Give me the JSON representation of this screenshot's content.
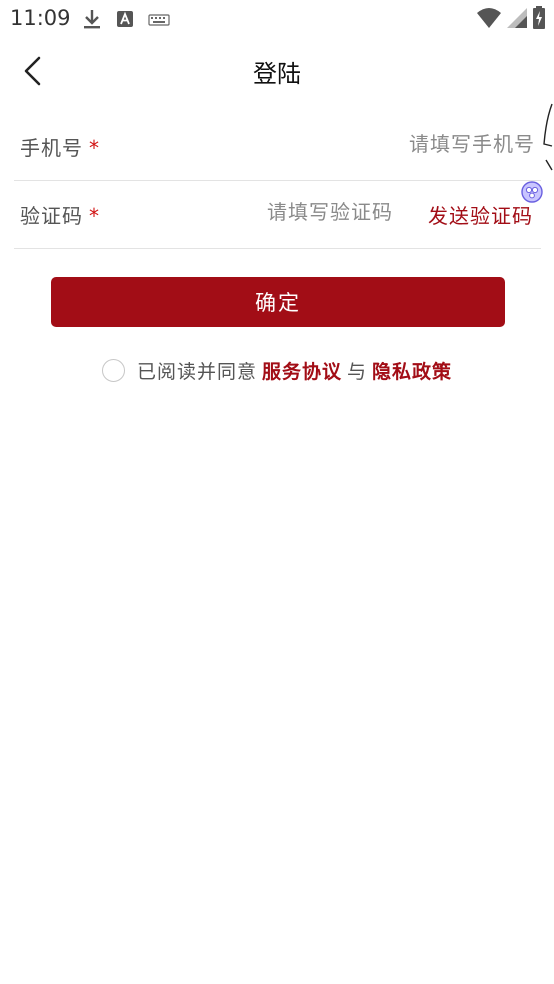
{
  "status_bar": {
    "time": "11:09",
    "left_icons": [
      "download-icon",
      "text-a-icon",
      "keyboard-icon"
    ],
    "right_icons": [
      "wifi-icon",
      "cellular-signal-icon",
      "battery-charging-icon"
    ]
  },
  "header": {
    "back_icon": "chevron-left-icon",
    "title": "登陆"
  },
  "form": {
    "phone": {
      "label": "手机号",
      "required_mark": "*",
      "value": "",
      "placeholder": "请填写手机号"
    },
    "code": {
      "label": "验证码",
      "required_mark": "*",
      "value": "",
      "placeholder": "请填写验证码",
      "send_label": "发送验证码"
    }
  },
  "confirm_label": "确定",
  "agreement": {
    "checked": false,
    "prefix": "已阅读并同意",
    "terms_link": "服务协议",
    "conjunction": "与",
    "privacy_link": "隐私政策"
  },
  "colors": {
    "accent": "#a20d16",
    "required": "#d21414",
    "placeholder": "#8a8a8a",
    "divider": "#e3e3e3"
  }
}
